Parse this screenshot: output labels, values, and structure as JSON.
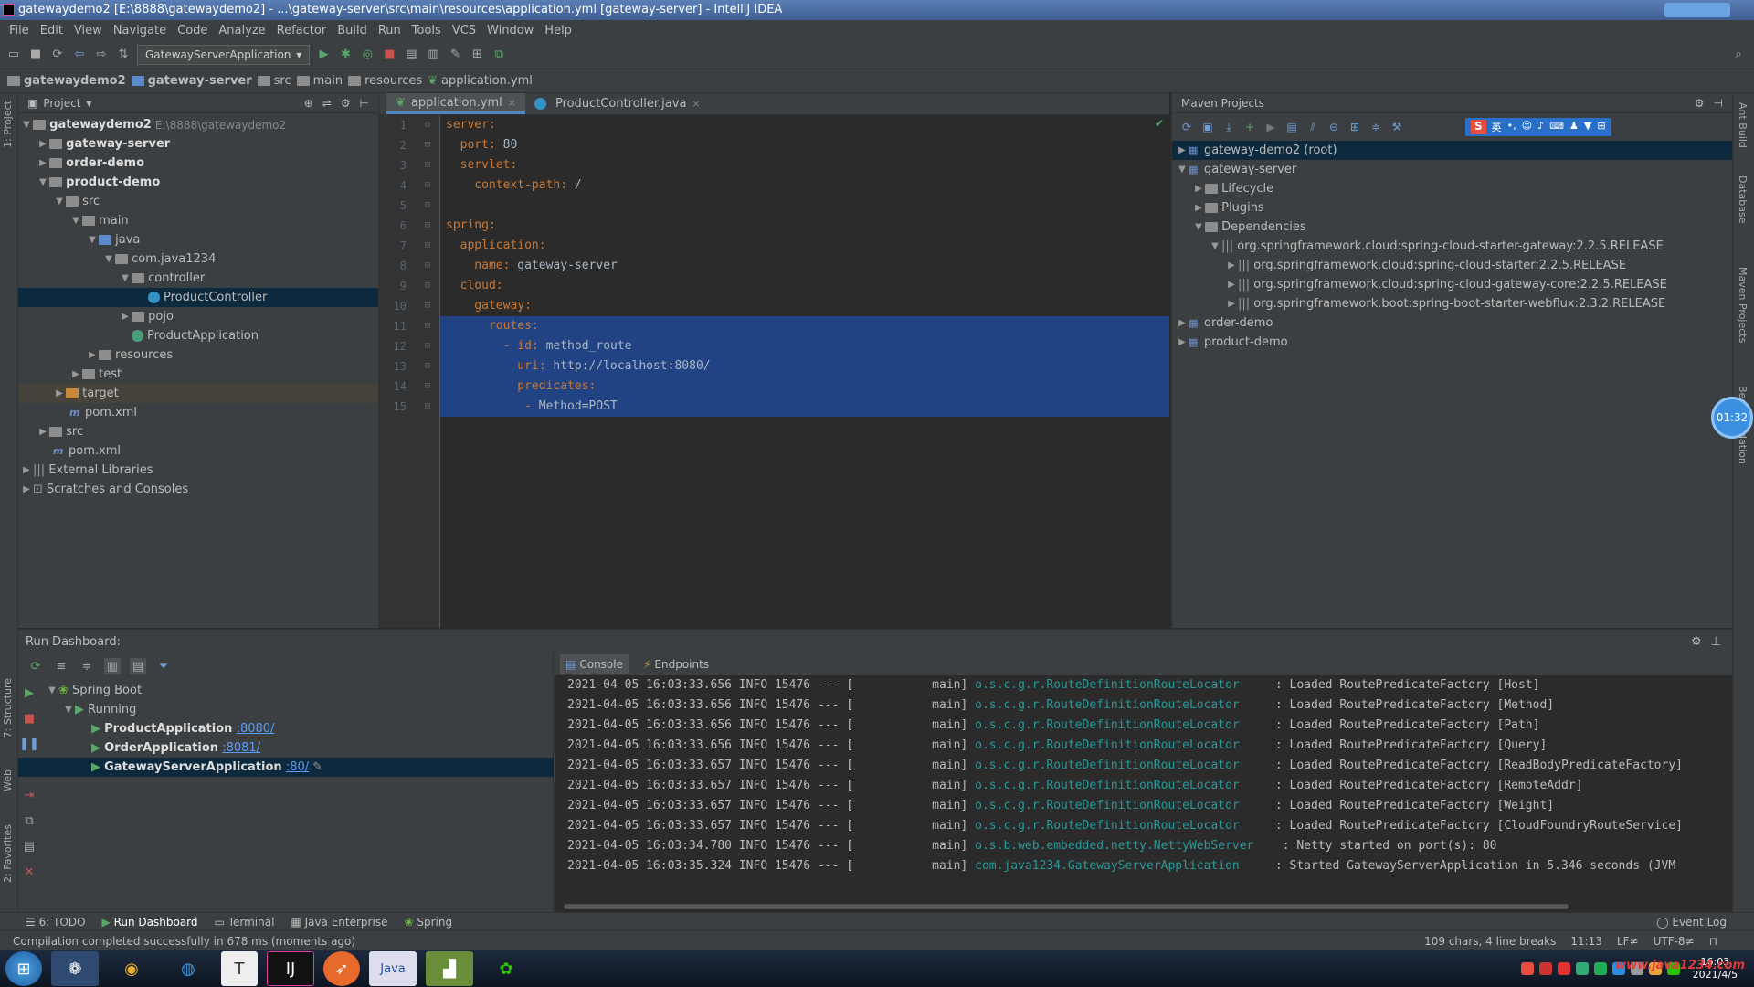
{
  "window": {
    "title": "gatewaydemo2 [E:\\8888\\gatewaydemo2] - ...\\gateway-server\\src\\main\\resources\\application.yml [gateway-server] - IntelliJ IDEA"
  },
  "menu": [
    "File",
    "Edit",
    "View",
    "Navigate",
    "Code",
    "Analyze",
    "Refactor",
    "Build",
    "Run",
    "Tools",
    "VCS",
    "Window",
    "Help"
  ],
  "toolbar": {
    "run_config": "GatewayServerApplication"
  },
  "breadcrumb": [
    "gatewaydemo2",
    "gateway-server",
    "src",
    "main",
    "resources",
    "application.yml"
  ],
  "project": {
    "header": "Project",
    "tree": [
      {
        "label": "gatewaydemo2",
        "extra": "E:\\8888\\gatewaydemo2",
        "bold": true
      },
      {
        "label": "gateway-server",
        "bold": true
      },
      {
        "label": "order-demo",
        "bold": true
      },
      {
        "label": "product-demo",
        "bold": true
      },
      {
        "label": "src"
      },
      {
        "label": "main"
      },
      {
        "label": "java"
      },
      {
        "label": "com.java1234"
      },
      {
        "label": "controller"
      },
      {
        "label": "ProductController"
      },
      {
        "label": "pojo"
      },
      {
        "label": "ProductApplication"
      },
      {
        "label": "resources"
      },
      {
        "label": "test"
      },
      {
        "label": "target"
      },
      {
        "label": "pom.xml"
      },
      {
        "label": "src"
      },
      {
        "label": "pom.xml"
      },
      {
        "label": "External Libraries"
      },
      {
        "label": "Scratches and Consoles"
      }
    ]
  },
  "editor": {
    "tabs": [
      "application.yml",
      "ProductController.java"
    ],
    "lines": [
      {
        "n": "1",
        "key": "server:",
        "val": ""
      },
      {
        "n": "2",
        "key": "  port:",
        "val": " 80"
      },
      {
        "n": "3",
        "key": "  servlet:",
        "val": ""
      },
      {
        "n": "4",
        "key": "    context-path:",
        "val": " /"
      },
      {
        "n": "5",
        "key": "",
        "val": ""
      },
      {
        "n": "6",
        "key": "spring:",
        "val": ""
      },
      {
        "n": "7",
        "key": "  application:",
        "val": ""
      },
      {
        "n": "8",
        "key": "    name:",
        "val": " gateway-server"
      },
      {
        "n": "9",
        "key": "  cloud:",
        "val": ""
      },
      {
        "n": "10",
        "key": "    gateway:",
        "val": ""
      },
      {
        "n": "11",
        "key": "      routes:",
        "val": ""
      },
      {
        "n": "12",
        "key": "        - id:",
        "val": " method_route"
      },
      {
        "n": "13",
        "key": "          uri:",
        "val": " http://localhost:8080/"
      },
      {
        "n": "14",
        "key": "          predicates:",
        "val": ""
      },
      {
        "n": "15",
        "key": "           - ",
        "val": "Method=POST"
      }
    ]
  },
  "maven": {
    "header": "Maven Projects",
    "tree": [
      {
        "label": "gateway-demo2 (root)"
      },
      {
        "label": "gateway-server"
      },
      {
        "label": "Lifecycle"
      },
      {
        "label": "Plugins"
      },
      {
        "label": "Dependencies"
      },
      {
        "label": "org.springframework.cloud:spring-cloud-starter-gateway:2.2.5.RELEASE"
      },
      {
        "label": "org.springframework.cloud:spring-cloud-starter:2.2.5.RELEASE"
      },
      {
        "label": "org.springframework.cloud:spring-cloud-gateway-core:2.2.5.RELEASE"
      },
      {
        "label": "org.springframework.boot:spring-boot-starter-webflux:2.3.2.RELEASE"
      },
      {
        "label": "order-demo"
      },
      {
        "label": "product-demo"
      }
    ]
  },
  "timer": "01:32",
  "run_dashboard": {
    "header": "Run Dashboard:",
    "spring_boot": "Spring Boot",
    "running": "Running",
    "apps": [
      {
        "name": "ProductApplication",
        "port": ":8080/"
      },
      {
        "name": "OrderApplication",
        "port": ":8081/"
      },
      {
        "name": "GatewayServerApplication",
        "port": ":80/"
      }
    ],
    "console_tabs": [
      "Console",
      "Endpoints"
    ],
    "log": [
      {
        "ts": "2021-04-05 16:03:33.656",
        "lvl": "INFO",
        "pid": "15476 --- [",
        "thr": "          main]",
        "cls": "o.s.c.g.r.RouteDefinitionRouteLocator   ",
        "msg": " : Loaded RoutePredicateFactory [Host]"
      },
      {
        "ts": "2021-04-05 16:03:33.656",
        "lvl": "INFO",
        "pid": "15476 --- [",
        "thr": "          main]",
        "cls": "o.s.c.g.r.RouteDefinitionRouteLocator   ",
        "msg": " : Loaded RoutePredicateFactory [Method]"
      },
      {
        "ts": "2021-04-05 16:03:33.656",
        "lvl": "INFO",
        "pid": "15476 --- [",
        "thr": "          main]",
        "cls": "o.s.c.g.r.RouteDefinitionRouteLocator   ",
        "msg": " : Loaded RoutePredicateFactory [Path]"
      },
      {
        "ts": "2021-04-05 16:03:33.656",
        "lvl": "INFO",
        "pid": "15476 --- [",
        "thr": "          main]",
        "cls": "o.s.c.g.r.RouteDefinitionRouteLocator   ",
        "msg": " : Loaded RoutePredicateFactory [Query]"
      },
      {
        "ts": "2021-04-05 16:03:33.657",
        "lvl": "INFO",
        "pid": "15476 --- [",
        "thr": "          main]",
        "cls": "o.s.c.g.r.RouteDefinitionRouteLocator   ",
        "msg": " : Loaded RoutePredicateFactory [ReadBodyPredicateFactory]"
      },
      {
        "ts": "2021-04-05 16:03:33.657",
        "lvl": "INFO",
        "pid": "15476 --- [",
        "thr": "          main]",
        "cls": "o.s.c.g.r.RouteDefinitionRouteLocator   ",
        "msg": " : Loaded RoutePredicateFactory [RemoteAddr]"
      },
      {
        "ts": "2021-04-05 16:03:33.657",
        "lvl": "INFO",
        "pid": "15476 --- [",
        "thr": "          main]",
        "cls": "o.s.c.g.r.RouteDefinitionRouteLocator   ",
        "msg": " : Loaded RoutePredicateFactory [Weight]"
      },
      {
        "ts": "2021-04-05 16:03:33.657",
        "lvl": "INFO",
        "pid": "15476 --- [",
        "thr": "          main]",
        "cls": "o.s.c.g.r.RouteDefinitionRouteLocator   ",
        "msg": " : Loaded RoutePredicateFactory [CloudFoundryRouteService]"
      },
      {
        "ts": "2021-04-05 16:03:34.780",
        "lvl": "INFO",
        "pid": "15476 --- [",
        "thr": "          main]",
        "cls": "o.s.b.web.embedded.netty.NettyWebServer  ",
        "msg": " : Netty started on port(s): 80"
      },
      {
        "ts": "2021-04-05 16:03:35.324",
        "lvl": "INFO",
        "pid": "15476 --- [",
        "thr": "          main]",
        "cls": "com.java1234.GatewayServerApplication   ",
        "msg": " : Started GatewayServerApplication in 5.346 seconds (JVM"
      }
    ]
  },
  "bottom_tabs": [
    "6: TODO",
    "Run Dashboard",
    "Terminal",
    "Java Enterprise",
    "Spring",
    "Event Log"
  ],
  "status": {
    "message": "Compilation completed successfully in 678 ms (moments ago)",
    "chars": "109 chars, 4 line breaks",
    "pos": "11:13",
    "lf": "LF≠",
    "enc": "UTF-8≠"
  },
  "left_strip": [
    "1: Project",
    "7: Structure",
    "Web",
    "2: Favorites"
  ],
  "right_strip": [
    "Ant Build",
    "Database",
    "Maven Projects",
    "Bean Validation"
  ],
  "taskbar": {
    "time": "16:03",
    "date": "2021/4/5",
    "watermark": "www.java1234.com"
  },
  "colors": {
    "accent": "#214283",
    "keyword": "#cc7832",
    "classname": "#299999",
    "link": "#589df6"
  }
}
